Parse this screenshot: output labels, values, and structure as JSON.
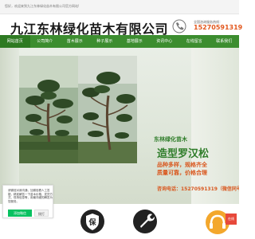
{
  "topbar": {
    "text": "您好，欢迎来到九江东林绿化苗木有限公司官方网站!"
  },
  "header": {
    "title": "九江东林绿化苗木有限公司",
    "hotline_label": "全国咨询服务热线：",
    "hotline_number": "15270591319"
  },
  "nav": {
    "items": [
      "网站首页",
      "公司简介",
      "苗木展示",
      "种子展示",
      "基地展示",
      "资讯中心",
      "在线留言",
      "联系我们"
    ]
  },
  "hero": {
    "company": "东林绿化苗木",
    "heading": "造型罗汉松",
    "line1": "品种多样，规格齐全",
    "line2": "质量可靠，价格合理",
    "contact": "咨询电话：15270591319（微信同号）"
  },
  "chat": {
    "text": "请微信对我沟通，加微信看人工答疑，精准解答一下苗木价格、发货方式、现场信息等，用最详细的解答为您服务。",
    "wechat_label": "添加微信",
    "tel_label": "拨打"
  },
  "service": {
    "consult_label": "在线"
  },
  "colors": {
    "nav": "#3c8d2f",
    "accent": "#d9571e",
    "brand_green": "#2f7d2a"
  },
  "icons": [
    "phone-icon",
    "shield-icon",
    "wrench-icon",
    "headset-icon"
  ]
}
